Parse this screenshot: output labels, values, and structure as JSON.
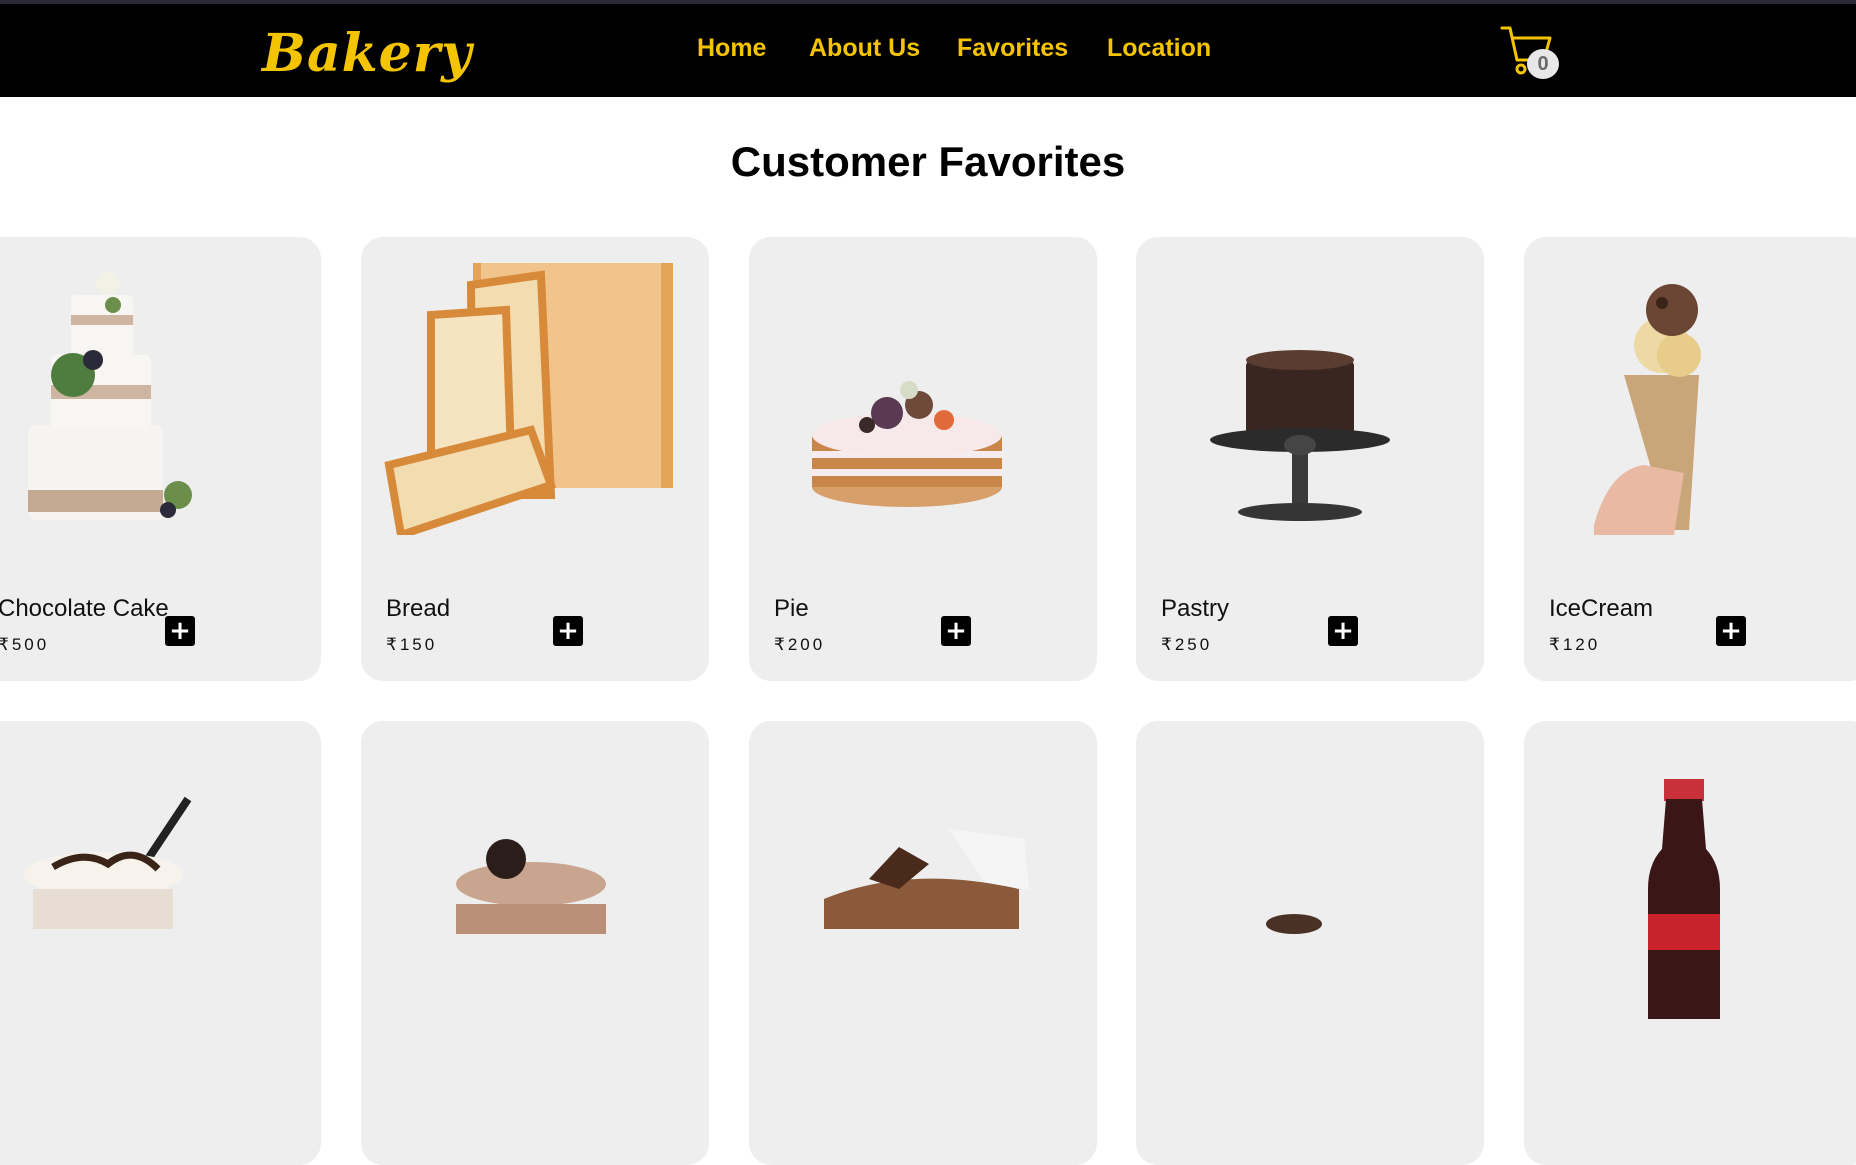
{
  "header": {
    "logo": "Bakery",
    "nav": [
      "Home",
      "About Us",
      "Favorites",
      "Location"
    ],
    "cart_count": "0",
    "cart_icon": "cart-icon"
  },
  "main": {
    "title": "Customer Favorites",
    "products": [
      {
        "name": "Chocolate Cake",
        "price": "₹500",
        "add": "+",
        "image": "layered-cake-image"
      },
      {
        "name": "Bread",
        "price": "₹150",
        "add": "+",
        "image": "bread-loaf-image"
      },
      {
        "name": "Pie",
        "price": "₹200",
        "add": "+",
        "image": "pie-image"
      },
      {
        "name": "Pastry",
        "price": "₹250",
        "add": "+",
        "image": "pastry-on-stand-image"
      },
      {
        "name": "IceCream",
        "price": "₹120",
        "add": "+",
        "image": "ice-cream-cone-image"
      }
    ],
    "second_row_images": [
      "frappe-image",
      "oreo-shake-image",
      "chocolate-cake-slice-image",
      "cookie-image",
      "cola-bottle-image"
    ]
  },
  "colors": {
    "accent": "#f5c400",
    "header_bg": "#000000",
    "card_bg": "#eeeeee"
  }
}
